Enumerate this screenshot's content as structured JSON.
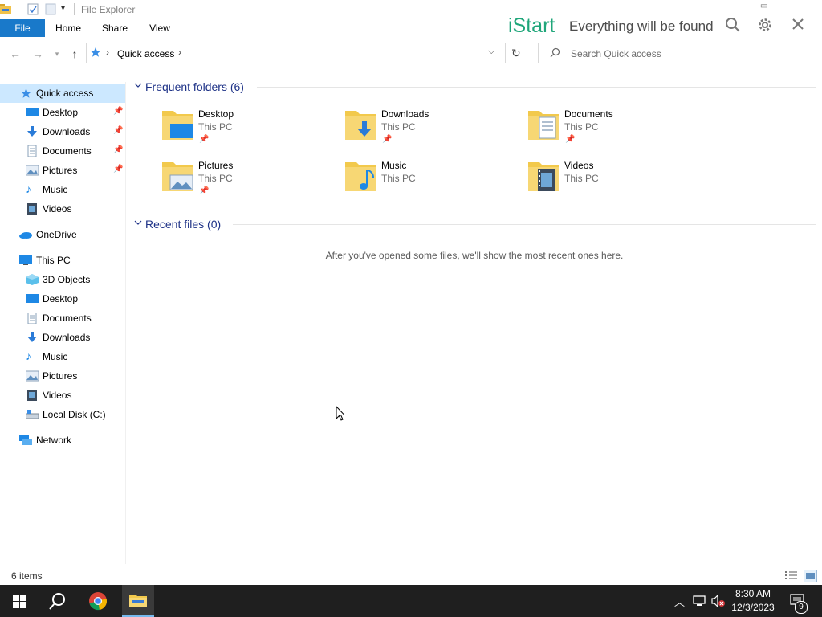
{
  "window": {
    "title": "File Explorer"
  },
  "ribbon": {
    "tabs": [
      "File",
      "Home",
      "Share",
      "View"
    ]
  },
  "address": {
    "path": "Quick access"
  },
  "search": {
    "placeholder": "Search Quick access"
  },
  "istart": {
    "brand": "iStart",
    "tagline": "Everything will be found"
  },
  "nav": {
    "items": [
      {
        "label": "Quick access",
        "icon": "star-icon"
      },
      {
        "label": "Desktop",
        "icon": "desktop-icon",
        "pinned": true
      },
      {
        "label": "Downloads",
        "icon": "download-icon",
        "pinned": true
      },
      {
        "label": "Documents",
        "icon": "document-icon",
        "pinned": true
      },
      {
        "label": "Pictures",
        "icon": "pictures-icon",
        "pinned": true
      },
      {
        "label": "Music",
        "icon": "music-icon"
      },
      {
        "label": "Videos",
        "icon": "video-icon"
      },
      {
        "label": "OneDrive",
        "icon": "cloud-icon"
      },
      {
        "label": "This PC",
        "icon": "computer-icon"
      },
      {
        "label": "3D Objects",
        "icon": "cube-icon"
      },
      {
        "label": "Desktop",
        "icon": "desktop-icon"
      },
      {
        "label": "Documents",
        "icon": "document-icon"
      },
      {
        "label": "Downloads",
        "icon": "download-icon"
      },
      {
        "label": "Music",
        "icon": "music-icon"
      },
      {
        "label": "Pictures",
        "icon": "pictures-icon"
      },
      {
        "label": "Videos",
        "icon": "video-icon"
      },
      {
        "label": "Local Disk (C:)",
        "icon": "drive-icon"
      },
      {
        "label": "Network",
        "icon": "network-icon"
      }
    ]
  },
  "main": {
    "frequent_heading": "Frequent folders (6)",
    "recent_heading": "Recent files (0)",
    "recent_empty": "After you've opened some files, we'll show the most recent ones here.",
    "folders": [
      {
        "name": "Desktop",
        "location": "This PC",
        "pinned": true,
        "icon": "desktop-folder-icon"
      },
      {
        "name": "Downloads",
        "location": "This PC",
        "pinned": true,
        "icon": "downloads-folder-icon"
      },
      {
        "name": "Documents",
        "location": "This PC",
        "pinned": true,
        "icon": "documents-folder-icon"
      },
      {
        "name": "Pictures",
        "location": "This PC",
        "pinned": true,
        "icon": "pictures-folder-icon"
      },
      {
        "name": "Music",
        "location": "This PC",
        "pinned": false,
        "icon": "music-folder-icon"
      },
      {
        "name": "Videos",
        "location": "This PC",
        "pinned": false,
        "icon": "videos-folder-icon"
      }
    ]
  },
  "status": {
    "item_count": "6 items"
  },
  "taskbar": {
    "time": "8:30 AM",
    "date": "12/3/2023",
    "notification_count": "9"
  },
  "colors": {
    "accent": "#1979ca",
    "istart_green": "#1fa67a",
    "section_heading": "#1e3287",
    "taskbar": "#1f1f1f"
  }
}
